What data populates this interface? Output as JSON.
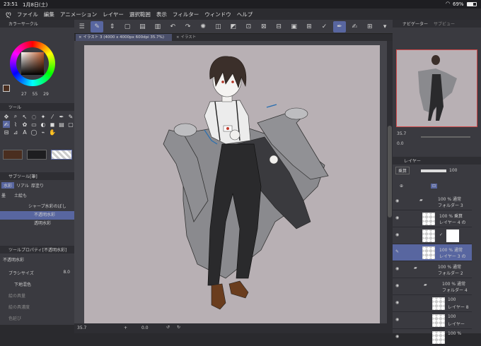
{
  "status_bar": {
    "time": "23:51",
    "date": "1月8日(土)",
    "wifi": "wifi-icon",
    "battery": "69%"
  },
  "menu": [
    "ファイル",
    "編集",
    "アニメーション",
    "レイヤー",
    "選択範囲",
    "表示",
    "フィルター",
    "ウィンドウ",
    "ヘルプ"
  ],
  "tabs": {
    "active": "イラスト 3 (4000 x 4000px 600dpi 35.7%)",
    "inactive": "イラスト"
  },
  "color_panel": {
    "title": "カラーサークル",
    "h": "27",
    "s": "55",
    "v": "29"
  },
  "tool_panel": {
    "title": "ツール"
  },
  "subtool_panel": {
    "title": "サブツール[筆]",
    "tabs": [
      "水彩",
      "リアル",
      "厚塗り",
      "墨",
      "土絵も"
    ],
    "items": [
      "シャープ水彩のばし",
      "不透明水彩",
      "透明水彩"
    ]
  },
  "prop_panel": {
    "title": "ツールプロパティ[不透明水彩]",
    "subtool_name": "不透明水彩",
    "brush_size_label": "ブラシサイズ",
    "brush_size_value": "8.0",
    "underlay_label": "下地混色",
    "paint_amount": "絵の具量",
    "paint_density": "絵の具濃度",
    "color_stretch": "色延び"
  },
  "bottom_bar": {
    "zoom": "35.7",
    "angle": "0.0"
  },
  "navigator": {
    "title": "ナビゲーター",
    "tab2": "サブビュー",
    "zoom": "35.7",
    "angle": "0.0"
  },
  "layers": {
    "title": "レイヤー",
    "blend_mode": "乗算",
    "opacity": "100",
    "rows": [
      {
        "line1": "100 % 通常",
        "line2": "フォルダー 3"
      },
      {
        "line1": "100 % 乗算",
        "line2": "レイヤー 4 の"
      },
      {
        "line1": "",
        "line2": ""
      },
      {
        "line1": "100 % 通常",
        "line2": "レイヤー 3 の"
      },
      {
        "line1": "100 % 通常",
        "line2": "フォルダー 2"
      },
      {
        "line1": "100 % 通常",
        "line2": "フォルダー 4"
      },
      {
        "line1": "100",
        "line2": "レイヤー 8"
      },
      {
        "line1": "100",
        "line2": "レイヤー"
      },
      {
        "line1": "100 %",
        "line2": ""
      }
    ]
  },
  "colors": {
    "canvas_bg": "#b8b0b4",
    "accent": "#5866a0"
  }
}
